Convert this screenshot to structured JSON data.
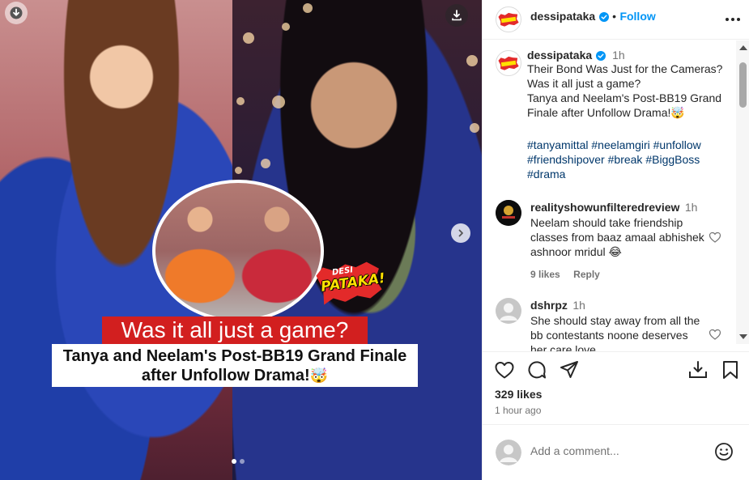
{
  "post": {
    "username": "dessipataka",
    "follow_label": "Follow",
    "more_label": "•••",
    "caption_time": "1h",
    "caption_lines": [
      "Their Bond Was Just for the Cameras?",
      "Was it all just a game?",
      "Tanya and Neelam's Post-BB19 Grand",
      "Finale after Unfollow Drama!"
    ],
    "caption_emoji": "🤯",
    "hashtags": [
      "#tanyamittal",
      "#neelamgiri",
      "#unfollow",
      "#friendshipover",
      "#break",
      "#BiggBoss",
      "#drama"
    ],
    "likes": "329 likes",
    "posted": "1 hour ago",
    "comment_placeholder": "Add a comment..."
  },
  "media": {
    "logo_top": "DESI",
    "logo_main": "PATAKA!",
    "headline_red": "Was it all just a game?",
    "headline_line1": "Tanya and Neelam's Post-BB19 Grand Finale",
    "headline_line2": "after Unfollow Drama!",
    "headline_emoji": "🤯",
    "carousel_total": 2,
    "carousel_active": 1
  },
  "comments": [
    {
      "username": "realityshowunfilteredreview",
      "time": "1h",
      "lines": [
        "Neelam should take friendship",
        "classes from baaz amaal abhishek",
        "ashnoor mridul"
      ],
      "emoji": "😂",
      "likes": "9 likes",
      "reply_label": "Reply"
    },
    {
      "username": "dshrpz",
      "time": "1h",
      "lines": [
        "She should stay away from all the",
        "bb contestants noone deserves",
        "her care love"
      ]
    }
  ],
  "colors": {
    "accent_blue": "#0095f6",
    "hashtag": "#00376b",
    "text": "#262626",
    "muted": "#737373",
    "logo_red": "#e32a2a",
    "logo_yellow": "#ffe100",
    "headline_red": "#d21f1f"
  },
  "icons": {
    "media_top_left": "download-icon",
    "media_top_right": "download-icon",
    "next": "chevron-right-icon",
    "verified": "verified-badge-icon",
    "more": "more-options-icon",
    "like": "heart-icon",
    "comment": "comment-icon",
    "share": "paper-plane-icon",
    "save": "bookmark-icon",
    "save_collection": "save-to-collection-icon",
    "emoji": "emoji-icon"
  }
}
